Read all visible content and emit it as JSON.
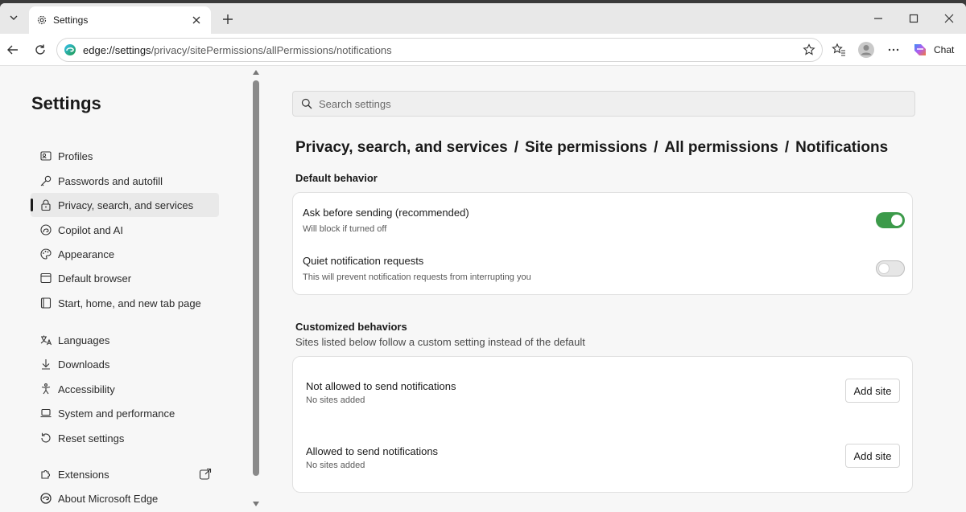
{
  "tab": {
    "title": "Settings"
  },
  "address": {
    "domain": "edge://settings",
    "path": "/privacy/sitePermissions/allPermissions/notifications"
  },
  "toolbar": {
    "chat_label": "Chat"
  },
  "sidebar": {
    "title": "Settings",
    "items": [
      {
        "label": "Profiles",
        "icon": "profile-icon"
      },
      {
        "label": "Passwords and autofill",
        "icon": "key-icon"
      },
      {
        "label": "Privacy, search, and services",
        "icon": "lock-icon",
        "active": true
      },
      {
        "label": "Copilot and AI",
        "icon": "copilot-icon"
      },
      {
        "label": "Appearance",
        "icon": "palette-icon"
      },
      {
        "label": "Default browser",
        "icon": "browser-icon"
      },
      {
        "label": "Start, home, and new tab page",
        "icon": "home-page-icon"
      },
      {
        "label": "Languages",
        "icon": "language-icon"
      },
      {
        "label": "Downloads",
        "icon": "download-icon"
      },
      {
        "label": "Accessibility",
        "icon": "accessibility-icon"
      },
      {
        "label": "System and performance",
        "icon": "laptop-icon"
      },
      {
        "label": "Reset settings",
        "icon": "reset-icon"
      },
      {
        "label": "Extensions",
        "icon": "extensions-icon"
      },
      {
        "label": "About Microsoft Edge",
        "icon": "edge-logo-icon"
      }
    ]
  },
  "search": {
    "placeholder": "Search settings"
  },
  "breadcrumb": [
    "Privacy, search, and services",
    "Site permissions",
    "All permissions",
    "Notifications"
  ],
  "breadcrumb_separator": "/",
  "default_behavior": {
    "title": "Default behavior",
    "rows": [
      {
        "title": "Ask before sending (recommended)",
        "subtitle": "Will block if turned off",
        "enabled": true
      },
      {
        "title": "Quiet notification requests",
        "subtitle": "This will prevent notification requests from interrupting you",
        "enabled": false
      }
    ]
  },
  "customized": {
    "title": "Customized behaviors",
    "subtitle": "Sites listed below follow a custom setting instead of the default",
    "rows": [
      {
        "title": "Not allowed to send notifications",
        "subtitle": "No sites added",
        "button": "Add site"
      },
      {
        "title": "Allowed to send notifications",
        "subtitle": "No sites added",
        "button": "Add site"
      }
    ]
  },
  "colors": {
    "toggle_on": "#3c9a4a",
    "accent_active": "#1a1a1a"
  }
}
